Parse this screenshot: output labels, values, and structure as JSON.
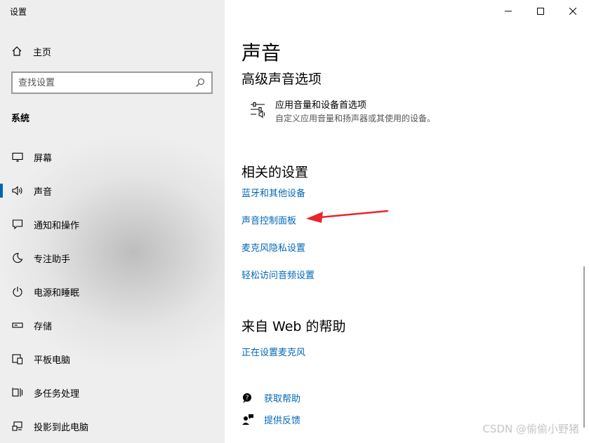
{
  "window": {
    "title": "设置"
  },
  "sidebar": {
    "home_label": "主页",
    "search_placeholder": "查找设置",
    "section_label": "系统",
    "items": [
      {
        "label": "屏幕",
        "icon": "monitor-icon"
      },
      {
        "label": "声音",
        "icon": "speaker-icon",
        "active": true
      },
      {
        "label": "通知和操作",
        "icon": "notification-icon"
      },
      {
        "label": "专注助手",
        "icon": "moon-icon"
      },
      {
        "label": "电源和睡眠",
        "icon": "power-icon"
      },
      {
        "label": "存储",
        "icon": "storage-icon"
      },
      {
        "label": "平板电脑",
        "icon": "tablet-icon"
      },
      {
        "label": "多任务处理",
        "icon": "multitask-icon"
      },
      {
        "label": "投影到此电脑",
        "icon": "project-icon"
      }
    ]
  },
  "main": {
    "page_title": "声音",
    "advanced_heading": "高级声音选项",
    "app_volume": {
      "title": "应用音量和设备首选项",
      "description": "自定义应用音量和扬声器或其使用的设备。"
    },
    "related_heading": "相关的设置",
    "related_links": [
      "蓝牙和其他设备",
      "声音控制面板",
      "麦克风隐私设置",
      "轻松访问音频设置"
    ],
    "web_heading": "来自 Web 的帮助",
    "web_links": [
      "正在设置麦克风"
    ],
    "help": {
      "get_help": "获取帮助",
      "feedback": "提供反馈"
    }
  },
  "watermark": "CSDN @偷偷小野猪",
  "colors": {
    "link": "#0067b8",
    "accent": "#0063b1",
    "arrow": "#e8262a"
  }
}
